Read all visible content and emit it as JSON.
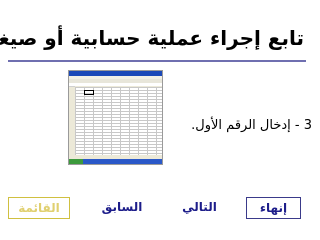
{
  "page": {
    "title": "تابع إجراء عملية حسابية أو صيغة",
    "step_text": "3 - إدخال الرقم الأول."
  },
  "buttons": {
    "finish": "إنهاء",
    "next": "التالي",
    "previous": "السابق",
    "menu": "القائمة"
  },
  "colors": {
    "accent": "#1d1d8a",
    "rule": "#6f6fb0",
    "menu_button": "#e0d070"
  }
}
